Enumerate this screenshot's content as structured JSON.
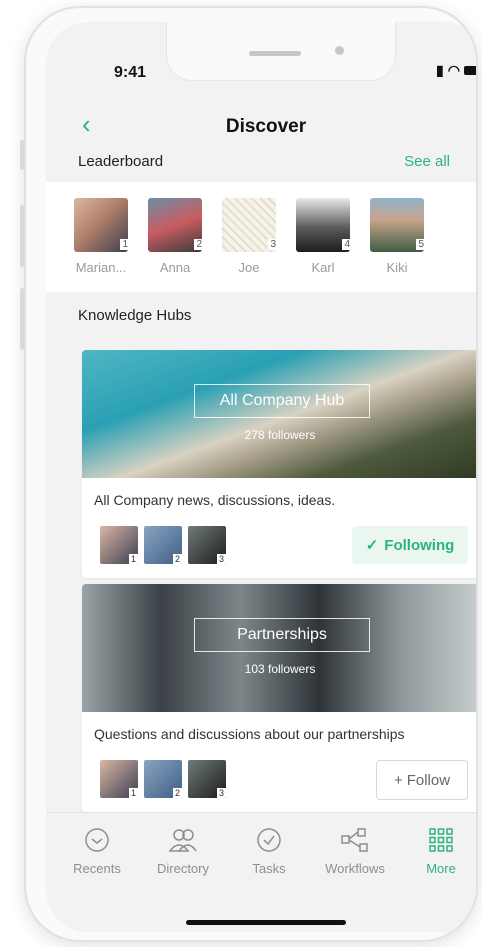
{
  "status": {
    "time": "9:41"
  },
  "header": {
    "title": "Discover"
  },
  "leaderboard": {
    "title": "Leaderboard",
    "see_all": "See all",
    "people": [
      {
        "name": "Marian...",
        "rank": "1"
      },
      {
        "name": "Anna",
        "rank": "2"
      },
      {
        "name": "Joe",
        "rank": "3"
      },
      {
        "name": "Karl",
        "rank": "4"
      },
      {
        "name": "Kiki",
        "rank": "5"
      }
    ]
  },
  "hubs_section": {
    "title": "Knowledge Hubs"
  },
  "hubs": [
    {
      "name": "All Company Hub",
      "followers": "278 followers",
      "description": "All Company news, discussions, ideas.",
      "avatar_ranks": [
        "1",
        "2",
        "3"
      ],
      "action": "Following",
      "action_icon": "check-icon"
    },
    {
      "name": "Partnerships",
      "followers": "103 followers",
      "description": "Questions and discussions about our partnerships",
      "avatar_ranks": [
        "1",
        "2",
        "3"
      ],
      "action": "Follow",
      "action_icon": "plus-icon"
    }
  ],
  "tabbar": {
    "tabs": [
      {
        "label": "Recents",
        "icon": "clock-icon"
      },
      {
        "label": "Directory",
        "icon": "people-icon"
      },
      {
        "label": "Tasks",
        "icon": "check-circle-icon"
      },
      {
        "label": "Workflows",
        "icon": "workflow-icon"
      },
      {
        "label": "More",
        "icon": "grid-icon",
        "active": true
      }
    ]
  },
  "colors": {
    "accent": "#2db37a",
    "background": "#f2f2f2"
  }
}
